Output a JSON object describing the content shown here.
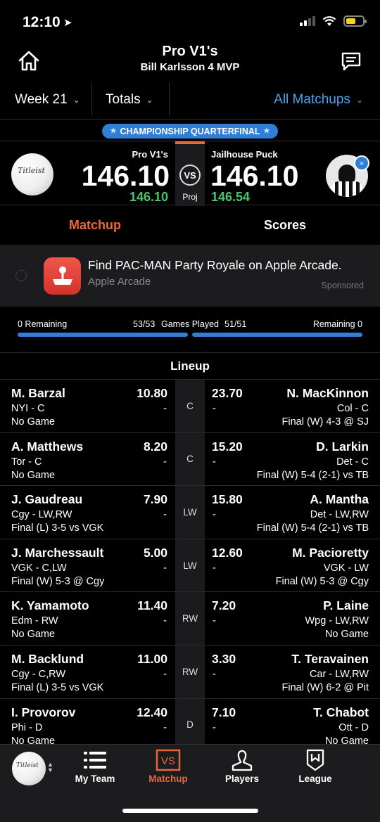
{
  "status": {
    "time": "12:10"
  },
  "header": {
    "title": "Pro V1's",
    "subtitle": "Bill Karlsson 4 MVP"
  },
  "filters": {
    "week": "Week 21",
    "totals": "Totals",
    "matchups": "All Matchups"
  },
  "badge": {
    "label": "CHAMPIONSHIP QUARTERFINAL"
  },
  "matchup": {
    "left": {
      "team": "Pro V1's",
      "score": "146.10",
      "proj": "146.10"
    },
    "right": {
      "team": "Jailhouse Puck",
      "score": "146.10",
      "proj": "146.54"
    },
    "vs": "VS",
    "proj_label": "Proj"
  },
  "tabs": {
    "matchup": "Matchup",
    "scores": "Scores"
  },
  "ad": {
    "title": "Find PAC-MAN Party Royale on Apple Arcade.",
    "subtitle": "Apple Arcade",
    "sponsored": "Sponsored"
  },
  "progress": {
    "left_remaining": "0 Remaining",
    "left_played": "53/53",
    "games_played": "Games Played",
    "right_played": "51/51",
    "right_remaining": "Remaining 0"
  },
  "lineup": {
    "title": "Lineup",
    "rows": [
      {
        "pos": "C",
        "l_name": "M. Barzal",
        "l_pts": "10.80",
        "l_team": "NYI - C",
        "l_dash": "-",
        "l_game": "No Game",
        "r_name": "N. MacKinnon",
        "r_pts": "23.70",
        "r_team": "Col - C",
        "r_dash": "-",
        "r_game": "Final (W) 4-3 @ SJ"
      },
      {
        "pos": "C",
        "l_name": "A. Matthews",
        "l_pts": "8.20",
        "l_team": "Tor - C",
        "l_dash": "-",
        "l_game": "No Game",
        "r_name": "D. Larkin",
        "r_pts": "15.20",
        "r_team": "Det - C",
        "r_dash": "-",
        "r_game": "Final (W) 5-4 (2-1) vs TB"
      },
      {
        "pos": "LW",
        "l_name": "J. Gaudreau",
        "l_pts": "7.90",
        "l_team": "Cgy - LW,RW",
        "l_dash": "-",
        "l_game": "Final (L) 3-5 vs VGK",
        "r_name": "A. Mantha",
        "r_pts": "15.80",
        "r_team": "Det - LW,RW",
        "r_dash": "-",
        "r_game": "Final (W) 5-4 (2-1) vs TB"
      },
      {
        "pos": "LW",
        "l_name": "J. Marchessault",
        "l_pts": "5.00",
        "l_team": "VGK - C,LW",
        "l_dash": "-",
        "l_game": "Final (W) 5-3 @ Cgy",
        "r_name": "M. Pacioretty",
        "r_pts": "12.60",
        "r_team": "VGK - LW",
        "r_dash": "-",
        "r_game": "Final (W) 5-3 @ Cgy"
      },
      {
        "pos": "RW",
        "l_name": "K. Yamamoto",
        "l_pts": "11.40",
        "l_team": "Edm - RW",
        "l_dash": "-",
        "l_game": "No Game",
        "r_name": "P. Laine",
        "r_pts": "7.20",
        "r_team": "Wpg - LW,RW",
        "r_dash": "-",
        "r_game": "No Game"
      },
      {
        "pos": "RW",
        "l_name": "M. Backlund",
        "l_pts": "11.00",
        "l_team": "Cgy - C,RW",
        "l_dash": "-",
        "l_game": "Final (L) 3-5 vs VGK",
        "r_name": "T. Teravainen",
        "r_pts": "3.30",
        "r_team": "Car - LW,RW",
        "r_dash": "-",
        "r_game": "Final (W) 6-2 @ Pit"
      },
      {
        "pos": "D",
        "l_name": "I. Provorov",
        "l_pts": "12.40",
        "l_team": "Phi - D",
        "l_dash": "-",
        "l_game": "No Game",
        "r_name": "T. Chabot",
        "r_pts": "7.10",
        "r_team": "Ott - D",
        "r_dash": "-",
        "r_game": "No Game"
      }
    ]
  },
  "nav": {
    "my_team": "My Team",
    "matchup": "Matchup",
    "players": "Players",
    "league": "League"
  },
  "colors": {
    "accent": "#e8683a",
    "link": "#4aa3f0",
    "badge": "#2f7fd6",
    "proj": "#4fc16b"
  },
  "icons": {
    "home": "home-icon",
    "chat": "chat-icon",
    "myteam": "list-icon",
    "matchup": "vs-icon",
    "players": "person-icon",
    "league": "shield-icon"
  }
}
